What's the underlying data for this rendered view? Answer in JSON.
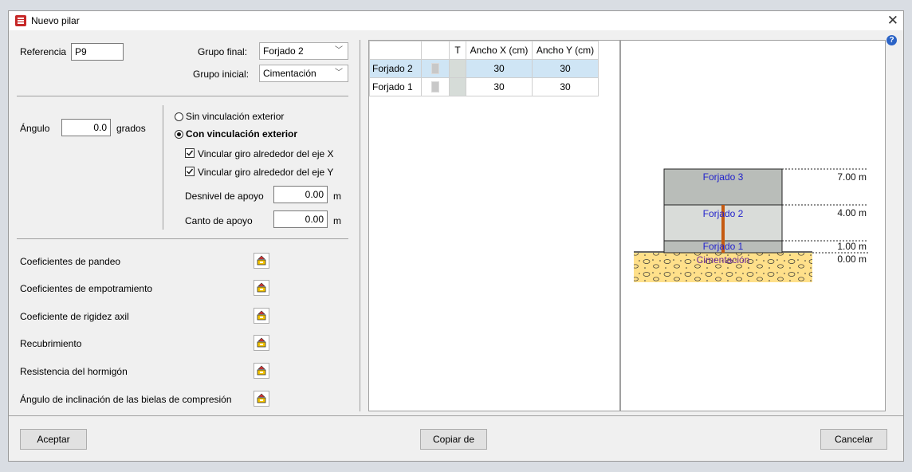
{
  "window": {
    "title": "Nuevo pilar"
  },
  "left": {
    "referencia_label": "Referencia",
    "referencia_value": "P9",
    "grupo_final_label": "Grupo final:",
    "grupo_final_value": "Forjado 2",
    "grupo_inicial_label": "Grupo inicial:",
    "grupo_inicial_value": "Cimentación",
    "angulo_label": "Ángulo",
    "angulo_value": "0.0",
    "angulo_unit": "grados",
    "radio_sin": "Sin vinculación exterior",
    "radio_con": "Con vinculación exterior",
    "check_x": "Vincular giro alrededor del eje X",
    "check_y": "Vincular giro alrededor del eje Y",
    "desnivel_label": "Desnivel de apoyo",
    "desnivel_value": "0.00",
    "canto_label": "Canto de apoyo",
    "canto_value": "0.00",
    "unit_m": "m",
    "coef_items": [
      "Coeficientes de pandeo",
      "Coeficientes de empotramiento",
      "Coeficiente de rigidez axil",
      "Recubrimiento",
      "Resistencia del hormigón",
      "Ángulo de inclinación de las bielas de compresión"
    ]
  },
  "table": {
    "headers": [
      "",
      "",
      "T",
      "Ancho X (cm)",
      "Ancho Y (cm)"
    ],
    "rows": [
      {
        "name": "Forjado 2",
        "ancho_x": "30",
        "ancho_y": "30",
        "selected": true
      },
      {
        "name": "Forjado 1",
        "ancho_x": "30",
        "ancho_y": "30",
        "selected": false
      }
    ]
  },
  "preview": {
    "levels": [
      {
        "name": "Forjado 3",
        "elev": "7.00 m"
      },
      {
        "name": "Forjado 2",
        "elev": "4.00 m"
      },
      {
        "name": "Forjado 1",
        "elev": "1.00 m"
      },
      {
        "name": "Cimentación",
        "elev": "0.00 m"
      }
    ],
    "colors": {
      "floor_upper": "#b9bdb9",
      "floor_middle": "#d9dcd9",
      "column": "#c55a11",
      "ground": "#ffe08a",
      "label": "#2222cc"
    }
  },
  "buttons": {
    "aceptar": "Aceptar",
    "copiar": "Copiar de",
    "cancelar": "Cancelar"
  }
}
